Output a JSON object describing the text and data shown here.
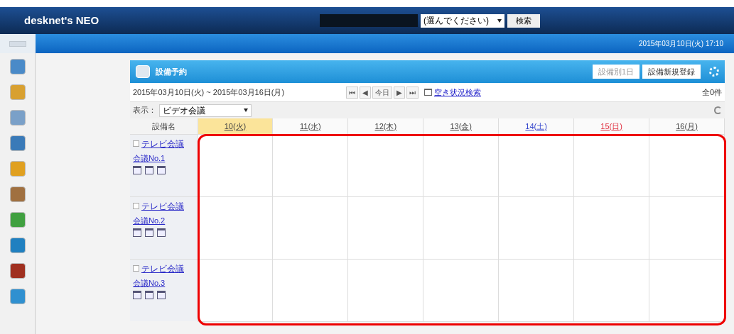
{
  "header": {
    "logo": "desknet's NEO",
    "search_select": "(選んでください)",
    "search_button": "検索",
    "datetime": "2015年03月10日(火) 17:10"
  },
  "panel": {
    "title": "設備予約",
    "buttons": [
      "設備別1日",
      "設備新規登録"
    ],
    "date_range": "2015年03月10日(火) ~ 2015年03月16日(月)",
    "nav": [
      "⏮",
      "◀",
      "今日",
      "▶",
      "⏭"
    ],
    "availability_link": "空き状況検索",
    "count": "全0件",
    "display_label": "表示：",
    "display_select": "ビデオ会議"
  },
  "table": {
    "columns": [
      {
        "label": "設備名",
        "kind": "name"
      },
      {
        "label": "10(火)",
        "kind": "today"
      },
      {
        "label": "11(水)",
        "kind": "weekday"
      },
      {
        "label": "12(木)",
        "kind": "weekday"
      },
      {
        "label": "13(金)",
        "kind": "weekday"
      },
      {
        "label": "14(土)",
        "kind": "saturday"
      },
      {
        "label": "15(日)",
        "kind": "sunday"
      },
      {
        "label": "16(月)",
        "kind": "weekday"
      }
    ],
    "rows": [
      {
        "name": "テレビ会議",
        "room": "会議No.1",
        "checked": false
      },
      {
        "name": "テレビ会議",
        "room": "会議No.2",
        "checked": false
      },
      {
        "name": "テレビ会議",
        "room": "会議No.3",
        "checked": false
      }
    ]
  }
}
